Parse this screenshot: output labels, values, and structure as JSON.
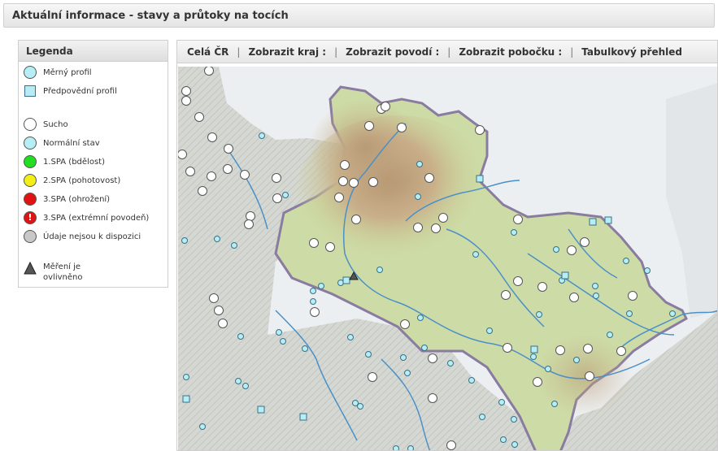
{
  "window": {
    "title": "Aktuální informace - stavy a průtoky na tocích"
  },
  "legend": {
    "title": "Legenda",
    "items": [
      {
        "label": "Měrný profil",
        "symbol": "circle",
        "color": "#b6eef6"
      },
      {
        "label": "Předpovědní profil",
        "symbol": "square",
        "color": "#b6eef6"
      },
      {
        "label": "Sucho",
        "symbol": "circle",
        "color": "#ffffff"
      },
      {
        "label": "Normální stav",
        "symbol": "circle",
        "color": "#b6eef6"
      },
      {
        "label": "1.SPA (bdělost)",
        "symbol": "circle",
        "color": "#22dd22"
      },
      {
        "label": "2.SPA (pohotovost)",
        "symbol": "circle",
        "color": "#f2ee16"
      },
      {
        "label": "3.SPA (ohrožení)",
        "symbol": "circle",
        "color": "#e01313"
      },
      {
        "label": "3.SPA (extrémní povodeň)",
        "symbol": "circle-exclamation",
        "color": "#e01313"
      },
      {
        "label": "Údaje nejsou k dispozici",
        "symbol": "circle",
        "color": "#c8c8c8"
      },
      {
        "label": "Měření je ovlivněno",
        "symbol": "triangle",
        "color": "#555555"
      }
    ]
  },
  "toolbar": {
    "items": [
      "Celá ČR",
      "Zobrazit kraj :",
      "Zobrazit povodí :",
      "Zobrazit pobočku :",
      "Tabulkový přehled"
    ],
    "separator": "|"
  },
  "map": {
    "icons": {
      "normal": "measurement-profile-icon",
      "dry": "dry-station-icon",
      "forecast": "forecast-profile-icon"
    },
    "colors": {
      "region": "#c8d8a0",
      "highland": "#c9ad86",
      "outside": "#e8ecef",
      "river": "#4a90c8",
      "border": "#7d6d95"
    }
  }
}
